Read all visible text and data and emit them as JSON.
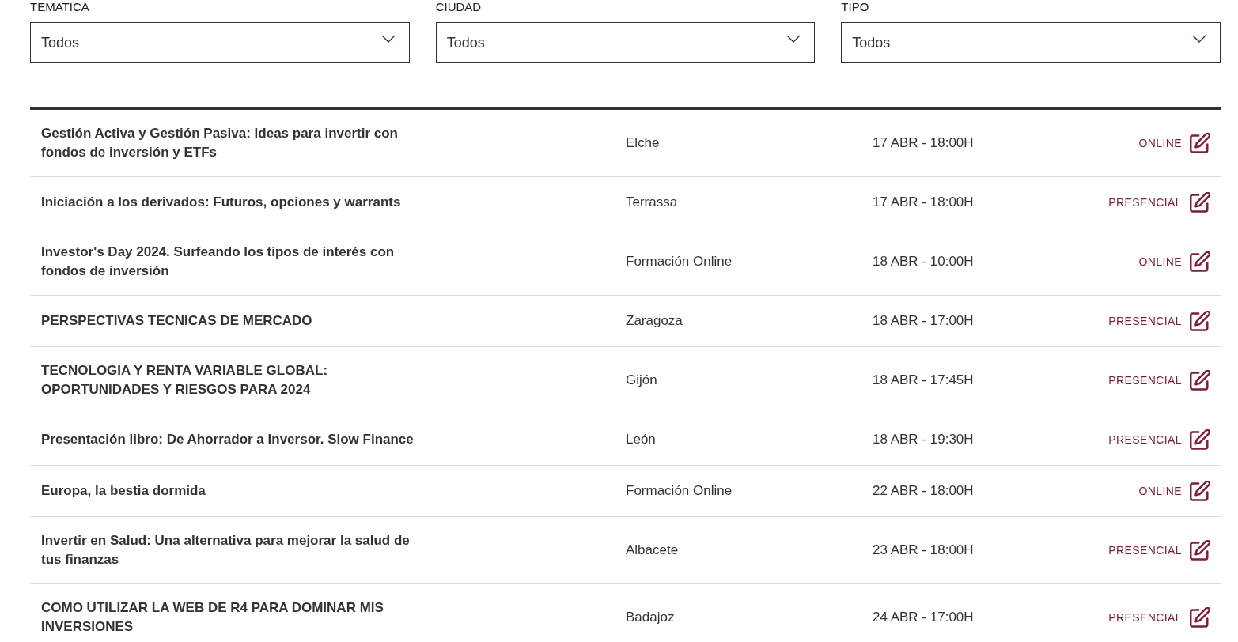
{
  "filters": [
    {
      "label": "TEMATICA",
      "value": "Todos"
    },
    {
      "label": "CIUDAD",
      "value": "Todos"
    },
    {
      "label": "TIPO",
      "value": "Todos"
    }
  ],
  "events": [
    {
      "title": "Gestión Activa y Gestión Pasiva: Ideas para invertir con\nfondos de inversión y ETFs",
      "city": "Elche",
      "date": "17 ABR - 18:00H",
      "type": "ONLINE"
    },
    {
      "title": "Iniciación a los derivados: Futuros, opciones y warrants",
      "city": "Terrassa",
      "date": "17 ABR - 18:00H",
      "type": "PRESENCIAL"
    },
    {
      "title": "Investor's Day 2024. Surfeando los tipos de interés con\nfondos de inversión",
      "city": "Formación Online",
      "date": "18 ABR - 10:00H",
      "type": "ONLINE"
    },
    {
      "title": "PERSPECTIVAS TECNICAS DE MERCADO",
      "city": "Zaragoza",
      "date": "18 ABR - 17:00H",
      "type": "PRESENCIAL"
    },
    {
      "title": "TECNOLOGIA Y RENTA VARIABLE GLOBAL:\nOPORTUNIDADES Y RIESGOS PARA 2024",
      "city": "Gijón",
      "date": "18 ABR - 17:45H",
      "type": "PRESENCIAL"
    },
    {
      "title": "Presentación libro: De Ahorrador a Inversor. Slow Finance",
      "city": "León",
      "date": "18 ABR - 19:30H",
      "type": "PRESENCIAL"
    },
    {
      "title": "Europa, la bestia dormida",
      "city": "Formación Online",
      "date": "22 ABR - 18:00H",
      "type": "ONLINE"
    },
    {
      "title": "Invertir en Salud: Una alternativa para mejorar la salud de\ntus finanzas",
      "city": "Albacete",
      "date": "23 ABR - 18:00H",
      "type": "PRESENCIAL"
    },
    {
      "title": "COMO UTILIZAR LA WEB DE R4 PARA DOMINAR MIS\nINVERSIONES",
      "city": "Badajoz",
      "date": "24 ABR - 17:00H",
      "type": "PRESENCIAL"
    }
  ]
}
